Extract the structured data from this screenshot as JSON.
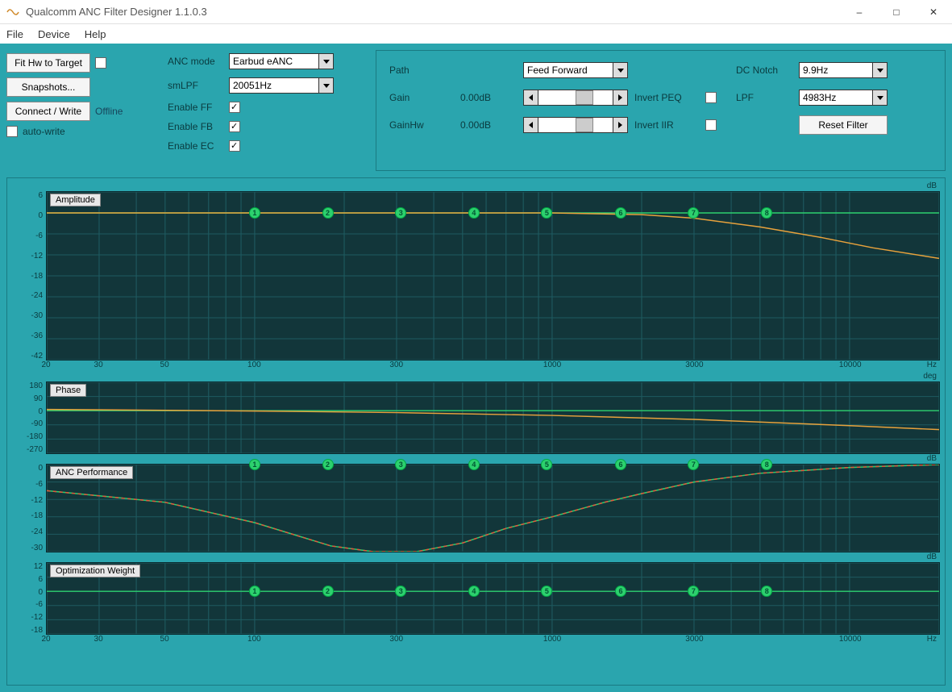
{
  "window": {
    "title": "Qualcomm ANC Filter Designer 1.1.0.3"
  },
  "menu": {
    "file": "File",
    "device": "Device",
    "help": "Help"
  },
  "left": {
    "fit_hw": "Fit Hw to Target",
    "snapshots": "Snapshots...",
    "connect": "Connect / Write",
    "offline": "Offline",
    "auto_write": "auto-write"
  },
  "mid": {
    "anc_mode_lbl": "ANC mode",
    "anc_mode_val": "Earbud eANC",
    "smlpf_lbl": "smLPF",
    "smlpf_val": "20051Hz",
    "en_ff": "Enable FF",
    "en_fb": "Enable FB",
    "en_ec": "Enable EC"
  },
  "right": {
    "path_lbl": "Path",
    "path_val": "Feed Forward",
    "gain_lbl": "Gain",
    "gain_val": "0.00dB",
    "gainhw_lbl": "GainHw",
    "gainhw_val": "0.00dB",
    "invert_peq": "Invert PEQ",
    "invert_iir": "Invert IIR",
    "dcnotch_lbl": "DC Notch",
    "dcnotch_val": "9.9Hz",
    "lpf_lbl": "LPF",
    "lpf_val": "4983Hz",
    "reset": "Reset Filter"
  },
  "chart_data": [
    {
      "title": "Amplitude",
      "type": "line",
      "y_unit": "dB",
      "ylim": [
        -42,
        6
      ],
      "yticks": [
        6,
        0,
        -6,
        -12,
        -18,
        -24,
        -30,
        -36,
        -42
      ],
      "x_unit": "Hz",
      "xscale": "log",
      "xlim": [
        20,
        20000
      ],
      "xticks": [
        20,
        30,
        50,
        100,
        300,
        1000,
        3000,
        10000
      ],
      "nodes": [
        100,
        176,
        310,
        546,
        960,
        1700,
        2990,
        5270
      ],
      "series": [
        {
          "name": "green",
          "color": "green",
          "x": [
            20,
            20000
          ],
          "y": [
            0,
            0
          ]
        },
        {
          "name": "orange",
          "color": "orange",
          "x": [
            20,
            100,
            300,
            1000,
            2000,
            3000,
            5000,
            8000,
            12000,
            20000
          ],
          "y": [
            0,
            0,
            0,
            0,
            -0.5,
            -1.5,
            -4,
            -7,
            -10,
            -13
          ]
        }
      ]
    },
    {
      "title": "Phase",
      "type": "line",
      "y_unit": "deg",
      "ylim": [
        -270,
        180
      ],
      "yticks": [
        180,
        90,
        0,
        -90,
        -180,
        -270
      ],
      "x_unit": "Hz",
      "xscale": "log",
      "xlim": [
        20,
        20000
      ],
      "series": [
        {
          "name": "green",
          "color": "green",
          "x": [
            20,
            20000
          ],
          "y": [
            0,
            0
          ]
        },
        {
          "name": "orange",
          "color": "orange",
          "x": [
            20,
            100,
            300,
            1000,
            3000,
            10000,
            20000
          ],
          "y": [
            8,
            -2,
            -12,
            -30,
            -55,
            -95,
            -120
          ]
        }
      ]
    },
    {
      "title": "ANC Performance",
      "type": "line",
      "y_unit": "dB",
      "ylim": [
        -30,
        0
      ],
      "yticks": [
        0,
        -6,
        -12,
        -18,
        -24,
        -30
      ],
      "x_unit": "Hz",
      "xscale": "log",
      "xlim": [
        20,
        20000
      ],
      "nodes": [
        100,
        176,
        310,
        546,
        960,
        1700,
        2990,
        5270
      ],
      "series": [
        {
          "name": "green",
          "color": "green",
          "x": [
            20,
            50,
            100,
            180,
            250,
            300,
            350,
            500,
            700,
            1000,
            1500,
            2000,
            3000,
            5000,
            10000,
            20000
          ],
          "y": [
            -9,
            -13,
            -20,
            -28,
            -30,
            -30,
            -30,
            -27,
            -22,
            -18,
            -13,
            -10,
            -6,
            -3,
            -1,
            0
          ]
        },
        {
          "name": "red",
          "color": "red",
          "x": [
            20,
            50,
            100,
            180,
            250,
            300,
            350,
            500,
            700,
            1000,
            1500,
            2000,
            3000,
            5000,
            10000,
            20000
          ],
          "y": [
            -9,
            -13,
            -20,
            -28,
            -30,
            -30,
            -30,
            -27,
            -22,
            -18,
            -13,
            -10,
            -6,
            -3,
            -1,
            0
          ]
        }
      ]
    },
    {
      "title": "Optimization Weight",
      "type": "line",
      "y_unit": "dB",
      "ylim": [
        -18,
        12
      ],
      "yticks": [
        12,
        6,
        0,
        -6,
        -12,
        -18
      ],
      "x_unit": "Hz",
      "xscale": "log",
      "xlim": [
        20,
        20000
      ],
      "xticks": [
        20,
        30,
        50,
        100,
        300,
        1000,
        3000,
        10000
      ],
      "nodes": [
        100,
        176,
        310,
        546,
        960,
        1700,
        2990,
        5270
      ],
      "series": [
        {
          "name": "green",
          "color": "green",
          "x": [
            20,
            20000
          ],
          "y": [
            0,
            0
          ]
        }
      ]
    }
  ]
}
